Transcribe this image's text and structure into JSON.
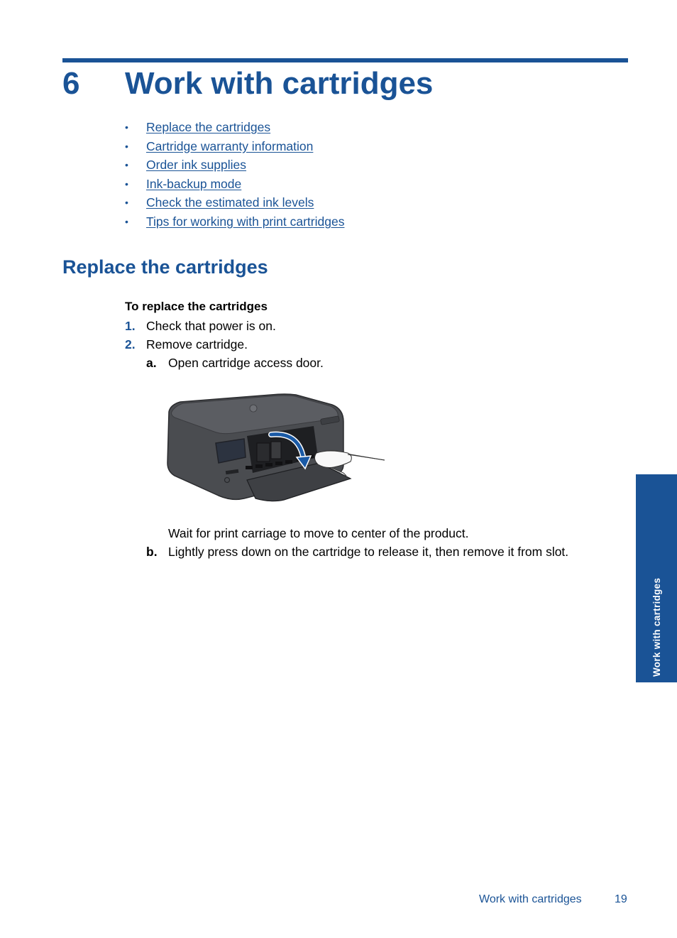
{
  "chapter": {
    "number": "6",
    "title": "Work with cartridges"
  },
  "toc": {
    "bullet": "•",
    "items": [
      {
        "label": "Replace the cartridges"
      },
      {
        "label": "Cartridge warranty information"
      },
      {
        "label": "Order ink supplies"
      },
      {
        "label": "Ink-backup mode"
      },
      {
        "label": "Check the estimated ink levels"
      },
      {
        "label": "Tips for working with print cartridges"
      }
    ]
  },
  "section": {
    "title": "Replace the cartridges",
    "procedure_heading": "To replace the cartridges",
    "steps": [
      {
        "number": "1.",
        "text": "Check that power is on."
      },
      {
        "number": "2.",
        "text": "Remove cartridge."
      }
    ],
    "substeps": [
      {
        "letter": "a",
        "text": "Open cartridge access door."
      },
      {
        "letter": "b",
        "text": "Lightly press down on the cartridge to release it, then remove it from slot."
      }
    ],
    "figure_caption_note": "Wait for print carriage to move to center of the product.",
    "figure": {
      "description": "printer-with-open-cartridge-door",
      "icon": "printer-illustration"
    }
  },
  "side_tab": {
    "label": "Work with cartridges"
  },
  "footer": {
    "section": "Work with cartridges",
    "page": "19"
  },
  "colors": {
    "accent": "#1a5396",
    "text": "#000000",
    "background": "#ffffff"
  }
}
